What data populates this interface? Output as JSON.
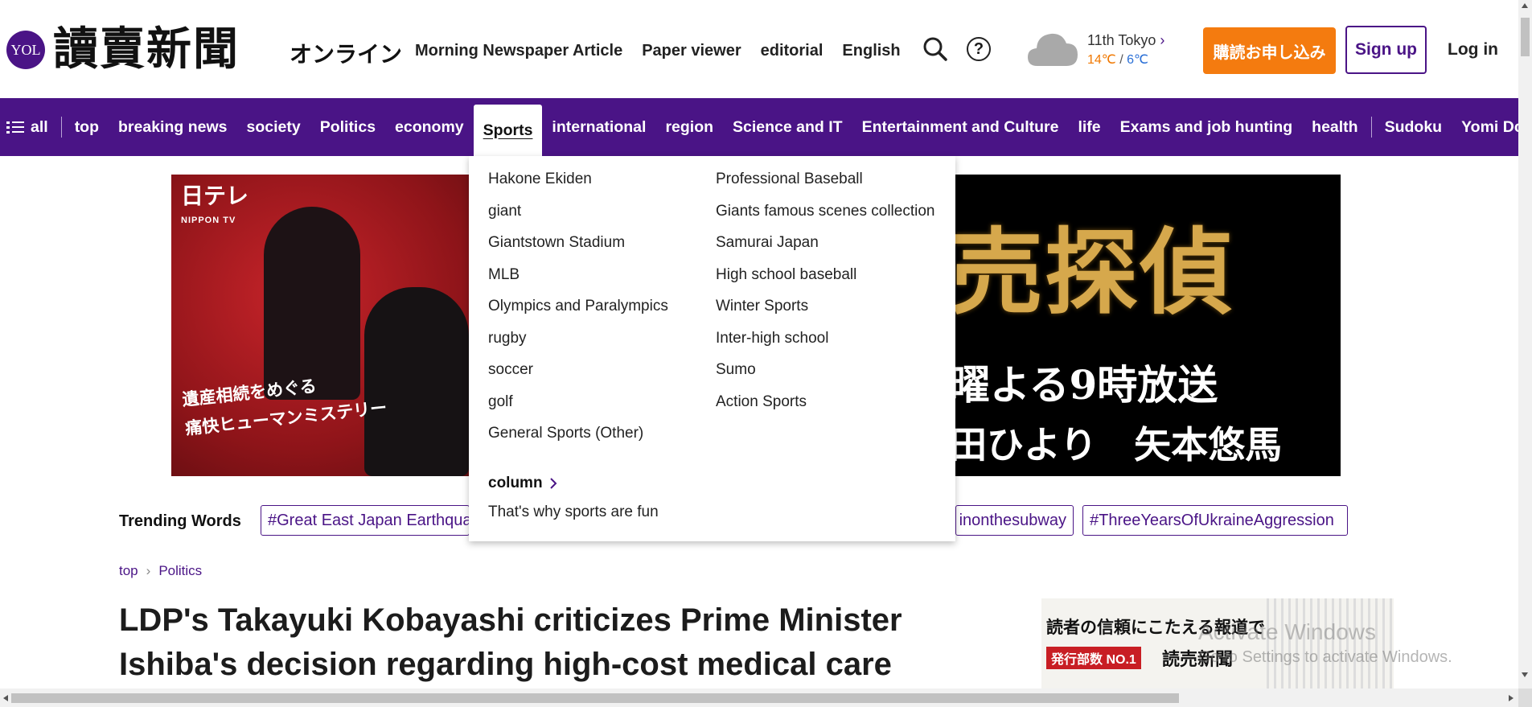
{
  "header": {
    "logo_badge": "YOL",
    "logo_title": "讀賣新聞",
    "logo_suffix": "オンライン",
    "top_links": [
      "Morning Newspaper Article",
      "Paper viewer",
      "editorial",
      "English"
    ],
    "weather": {
      "location": "11th Tokyo",
      "high": "14℃",
      "separator": "/",
      "low": "6℃"
    },
    "subscribe_label": "購読お申し込み",
    "signup_label": "Sign up",
    "login_label": "Log in"
  },
  "nav": {
    "all_label": "all",
    "items": [
      "top",
      "breaking news",
      "society",
      "Politics",
      "economy",
      "Sports",
      "international",
      "region",
      "Science and IT",
      "Entertainment and Culture",
      "life",
      "Exams and job hunting",
      "health"
    ],
    "extra_items": [
      "Sudoku",
      "Yomi Do"
    ],
    "active": "Sports"
  },
  "banner": {
    "network_logo": "日テレ",
    "network_sub": "NIPPON TV",
    "tagline_line1": "遺産相続をめぐる",
    "tagline_line2": "痛快ヒューマンミステリー",
    "title_fragment": "売探偵",
    "subtitle_fragment": "曜よる9時放送",
    "cast_fragment": "田ひより　矢本悠馬"
  },
  "dropdown": {
    "col1": [
      "Hakone Ekiden",
      "giant",
      "Giantstown Stadium",
      "MLB",
      "Olympics and Paralympics",
      "rugby",
      "soccer",
      "golf",
      "General Sports (Other)"
    ],
    "col2": [
      "Professional Baseball",
      "Giants famous scenes collection",
      "Samurai Japan",
      "High school baseball",
      "Winter Sports",
      "Inter-high school",
      "Sumo",
      "Action Sports"
    ],
    "column_heading": "column",
    "column_item": "That's why sports are fun"
  },
  "trending": {
    "label": "Trending Words",
    "tags": [
      "#Great East Japan Earthquake",
      "#...inonthesubway",
      "#ThreeYearsOfUkraineAggression"
    ],
    "tags_visible": [
      "#Great East Japan Earthqua",
      "inonthesubway",
      "#ThreeYearsOfUkraineAggression"
    ]
  },
  "breadcrumb": {
    "items": [
      "top",
      "Politics"
    ]
  },
  "article": {
    "headline": "LDP's Takayuki Kobayashi criticizes Prime Minister Ishiba's decision regarding high-cost medical care"
  },
  "side_ad": {
    "tagline": "読者の信頼にこたえる報道で",
    "badge": "発行部数 NO.1",
    "name": "読売新聞"
  },
  "os_watermark": {
    "line1": "Activate Windows",
    "line2": "Go to Settings to activate Windows."
  },
  "colors": {
    "brand_purple": "#4a1486",
    "subscribe_orange": "#f47b0f",
    "temp_high": "#f07800",
    "temp_low": "#2a6fd6"
  }
}
